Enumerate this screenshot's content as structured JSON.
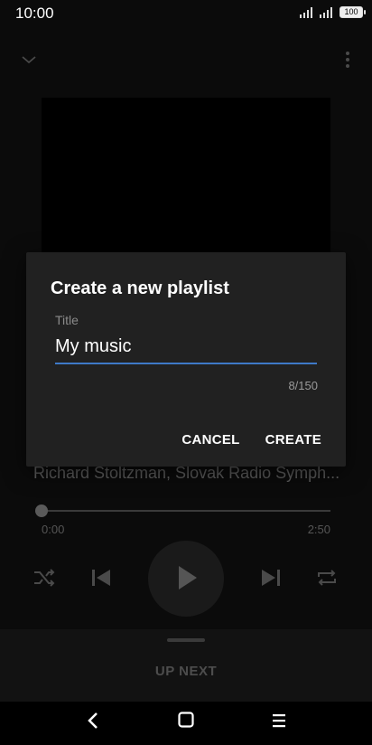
{
  "status_bar": {
    "time": "10:00",
    "battery": "100"
  },
  "player": {
    "artist_line": "Richard Stoltzman, Slovak Radio Symph...",
    "progress": {
      "current_time": "0:00",
      "total_time": "2:50",
      "fraction": 0.0
    }
  },
  "up_next": {
    "label": "UP NEXT"
  },
  "dialog": {
    "title": "Create a new playlist",
    "field_label": "Title",
    "input_value": "My music",
    "char_counter": "8/150",
    "cancel_label": "CANCEL",
    "create_label": "CREATE"
  },
  "colors": {
    "background": "#0b0b0b",
    "dialog_background": "#212121",
    "accent": "#3e79c7"
  }
}
